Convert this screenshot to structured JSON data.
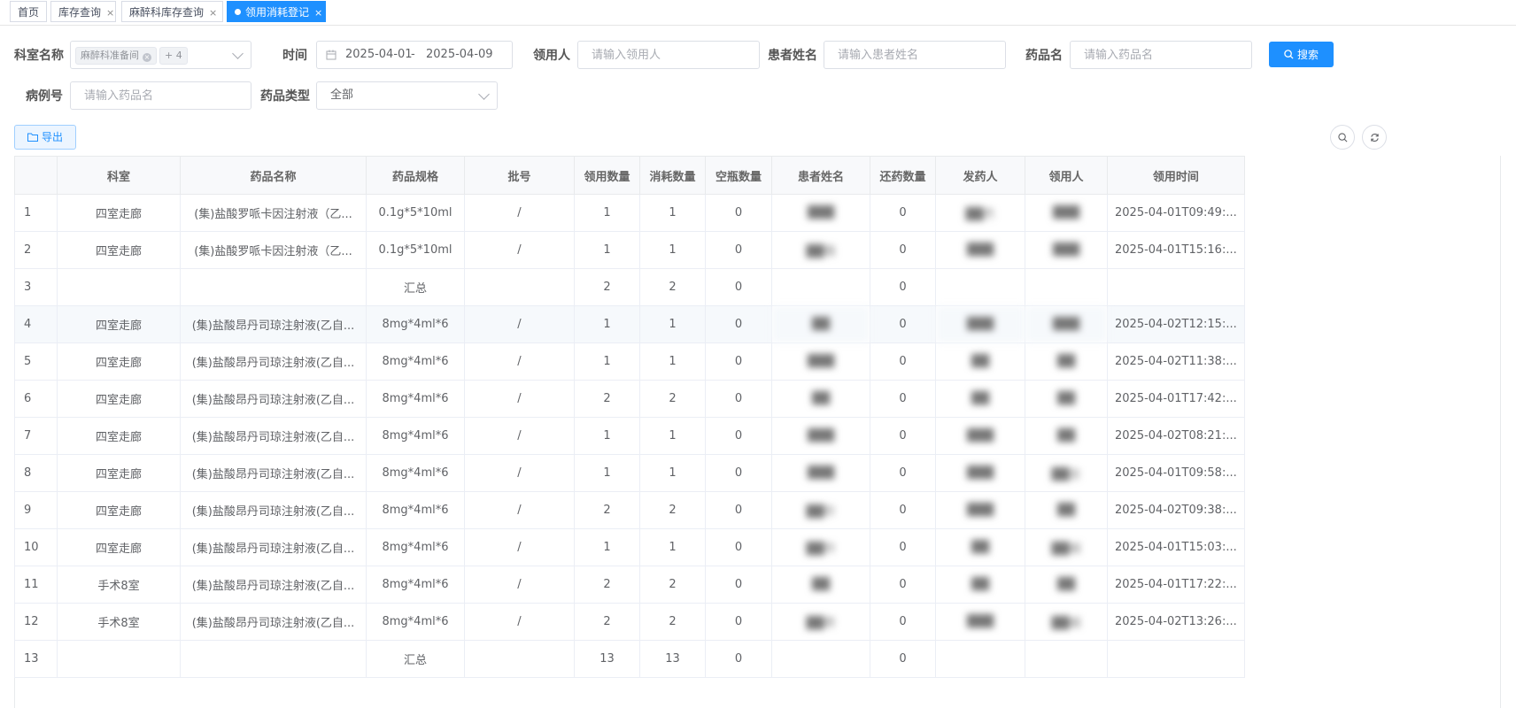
{
  "tabs": [
    {
      "label": "首页",
      "closable": false,
      "active": false
    },
    {
      "label": "库存查询",
      "closable": true,
      "active": false
    },
    {
      "label": "麻醉科库存查询",
      "closable": true,
      "active": false
    },
    {
      "label": "领用消耗登记",
      "closable": true,
      "active": true
    }
  ],
  "close_glyph": "×",
  "filters": {
    "dept_label": "科室名称",
    "dept_tag": "麻醉科准备间",
    "dept_more": "+ 4",
    "time_label": "时间",
    "date_start": "2025-04-01",
    "date_sep": "-",
    "date_end": "2025-04-09",
    "receiver_label": "领用人",
    "receiver_placeholder": "请输入领用人",
    "patient_label": "患者姓名",
    "patient_placeholder": "请输入患者姓名",
    "drug_label": "药品名",
    "drug_placeholder": "请输入药品名",
    "search_label": "搜索",
    "case_label": "病例号",
    "case_placeholder": "请输入药品名",
    "type_label": "药品类型",
    "type_value": "全部"
  },
  "toolbar": {
    "export_label": "导出"
  },
  "icons": {
    "search": "search-icon",
    "calendar": "calendar-icon",
    "folder": "folder-icon",
    "refresh": "refresh-icon"
  },
  "colors": {
    "primary": "#1e90ff",
    "header_bg": "#f8f9fb",
    "border": "#ebeef5"
  },
  "table": {
    "columns": [
      "",
      "科室",
      "药品名称",
      "药品规格",
      "批号",
      "领用数量",
      "消耗数量",
      "空瓶数量",
      "患者姓名",
      "还药数量",
      "发药人",
      "领用人",
      "领用时间"
    ],
    "rows": [
      [
        "1",
        "四室走廊",
        "(集)盐酸罗哌卡因注射液（乙...",
        "0.1g*5*10ml",
        "/",
        "1",
        "1",
        "0",
        "███",
        "0",
        "██杰",
        "███",
        "2025-04-01T09:49:..."
      ],
      [
        "2",
        "四室走廊",
        "(集)盐酸罗哌卡因注射液（乙...",
        "0.1g*5*10ml",
        "/",
        "1",
        "1",
        "0",
        "██强",
        "0",
        "███",
        "███",
        "2025-04-01T15:16:..."
      ],
      [
        "3",
        "",
        "",
        "汇总",
        "",
        "2",
        "2",
        "0",
        "",
        "0",
        "",
        "",
        ""
      ],
      [
        "4",
        "四室走廊",
        "(集)盐酸昂丹司琼注射液(乙自...",
        "8mg*4ml*6",
        "/",
        "1",
        "1",
        "0",
        "██",
        "0",
        "███",
        "███",
        "2025-04-02T12:15:..."
      ],
      [
        "5",
        "四室走廊",
        "(集)盐酸昂丹司琼注射液(乙自...",
        "8mg*4ml*6",
        "/",
        "1",
        "1",
        "0",
        "███",
        "0",
        "██",
        "██",
        "2025-04-02T11:38:..."
      ],
      [
        "6",
        "四室走廊",
        "(集)盐酸昂丹司琼注射液(乙自...",
        "8mg*4ml*6",
        "/",
        "2",
        "2",
        "0",
        "██",
        "0",
        "██",
        "██",
        "2025-04-01T17:42:..."
      ],
      [
        "7",
        "四室走廊",
        "(集)盐酸昂丹司琼注射液(乙自...",
        "8mg*4ml*6",
        "/",
        "1",
        "1",
        "0",
        "███",
        "0",
        "███",
        "██",
        "2025-04-02T08:21:..."
      ],
      [
        "8",
        "四室走廊",
        "(集)盐酸昂丹司琼注射液(乙自...",
        "8mg*4ml*6",
        "/",
        "1",
        "1",
        "0",
        "███",
        "0",
        "███",
        "██全",
        "2025-04-01T09:58:..."
      ],
      [
        "9",
        "四室走廊",
        "(集)盐酸昂丹司琼注射液(乙自...",
        "8mg*4ml*6",
        "/",
        "2",
        "2",
        "0",
        "██珍",
        "0",
        "███",
        "██",
        "2025-04-02T09:38:..."
      ],
      [
        "10",
        "四室走廊",
        "(集)盐酸昂丹司琼注射液(乙自...",
        "8mg*4ml*6",
        "/",
        "1",
        "1",
        "0",
        "██玲",
        "0",
        "██",
        "██城",
        "2025-04-01T15:03:..."
      ],
      [
        "11",
        "手术8室",
        "(集)盐酸昂丹司琼注射液(乙自...",
        "8mg*4ml*6",
        "/",
        "2",
        "2",
        "0",
        "██",
        "0",
        "██",
        "██",
        "2025-04-01T17:22:..."
      ],
      [
        "12",
        "手术8室",
        "(集)盐酸昂丹司琼注射液(乙自...",
        "8mg*4ml*6",
        "/",
        "2",
        "2",
        "0",
        "██奇",
        "0",
        "███",
        "██城",
        "2025-04-02T13:26:..."
      ],
      [
        "13",
        "",
        "",
        "汇总",
        "",
        "13",
        "13",
        "0",
        "",
        "0",
        "",
        "",
        ""
      ]
    ],
    "blurred_columns": [
      8,
      10,
      11
    ],
    "highlight_row": 4
  }
}
